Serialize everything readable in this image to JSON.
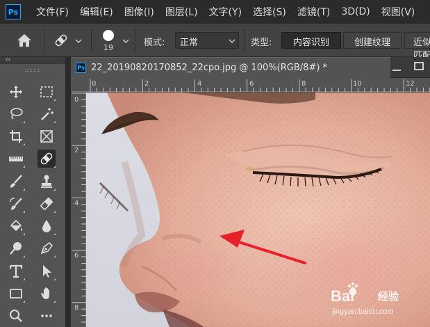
{
  "app": {
    "logo": "Ps"
  },
  "menu": [
    "文件(F)",
    "编辑(E)",
    "图像(I)",
    "图层(L)",
    "文字(Y)",
    "选择(S)",
    "滤镜(T)",
    "3D(D)",
    "视图(V)"
  ],
  "options_bar": {
    "brush_size": "19",
    "mode_label": "模式:",
    "mode_value": "正常",
    "type_label": "类型:",
    "type_buttons": [
      "内容识别",
      "创建纹理",
      "近似匹配"
    ],
    "active_type": "内容识别"
  },
  "toolbar": {
    "collapse_glyph": "‹‹",
    "tools": [
      {
        "name": "move-tool",
        "icon": "move-icon"
      },
      {
        "name": "rectangular-marquee-tool",
        "icon": "marquee-icon"
      },
      {
        "name": "lasso-tool",
        "icon": "lasso-icon"
      },
      {
        "name": "magic-wand-tool",
        "icon": "magic-wand-icon"
      },
      {
        "name": "crop-tool",
        "icon": "crop-icon"
      },
      {
        "name": "frame-tool",
        "icon": "frame-icon"
      },
      {
        "name": "ruler-tool",
        "icon": "ruler-icon"
      },
      {
        "name": "spot-healing-brush-tool",
        "icon": "bandage-icon",
        "active": true
      },
      {
        "name": "brush-tool",
        "icon": "brush-icon"
      },
      {
        "name": "clone-stamp-tool",
        "icon": "stamp-icon"
      },
      {
        "name": "history-brush-tool",
        "icon": "history-brush-icon"
      },
      {
        "name": "eraser-tool",
        "icon": "eraser-icon"
      },
      {
        "name": "paint-bucket-tool",
        "icon": "bucket-icon"
      },
      {
        "name": "blur-tool",
        "icon": "drop-icon"
      },
      {
        "name": "dodge-tool",
        "icon": "dodge-icon"
      },
      {
        "name": "pen-tool",
        "icon": "pen-icon"
      },
      {
        "name": "type-tool",
        "icon": "type-icon"
      },
      {
        "name": "path-selection-tool",
        "icon": "arrow-icon"
      },
      {
        "name": "rectangle-tool",
        "icon": "rectangle-icon"
      },
      {
        "name": "hand-tool",
        "icon": "hand-icon"
      },
      {
        "name": "zoom-tool",
        "icon": "zoom-icon"
      },
      {
        "name": "more-tools",
        "icon": "ellipsis-icon"
      }
    ]
  },
  "document": {
    "icon_label": "Ps",
    "title": "22_20190820170852_22cpo.jpg @ 100%(RGB/8#) *",
    "ruler_top_labels": [
      "0",
      "2",
      "4",
      "6",
      "8",
      "10",
      "12"
    ],
    "ruler_left_labels": [
      "0",
      "2",
      "4",
      "6",
      "8"
    ]
  },
  "watermark": {
    "brand_latin": "Bai",
    "brand_cn": "经验",
    "url": "jingyan.baidu.com"
  },
  "colors": {
    "menubar": "#2b2b2b",
    "options_bar": "#434343",
    "panel": "#535353",
    "active_tool": "#2c2c2c",
    "ps_blue": "#31a8ff",
    "arrow": "#e8202a"
  }
}
